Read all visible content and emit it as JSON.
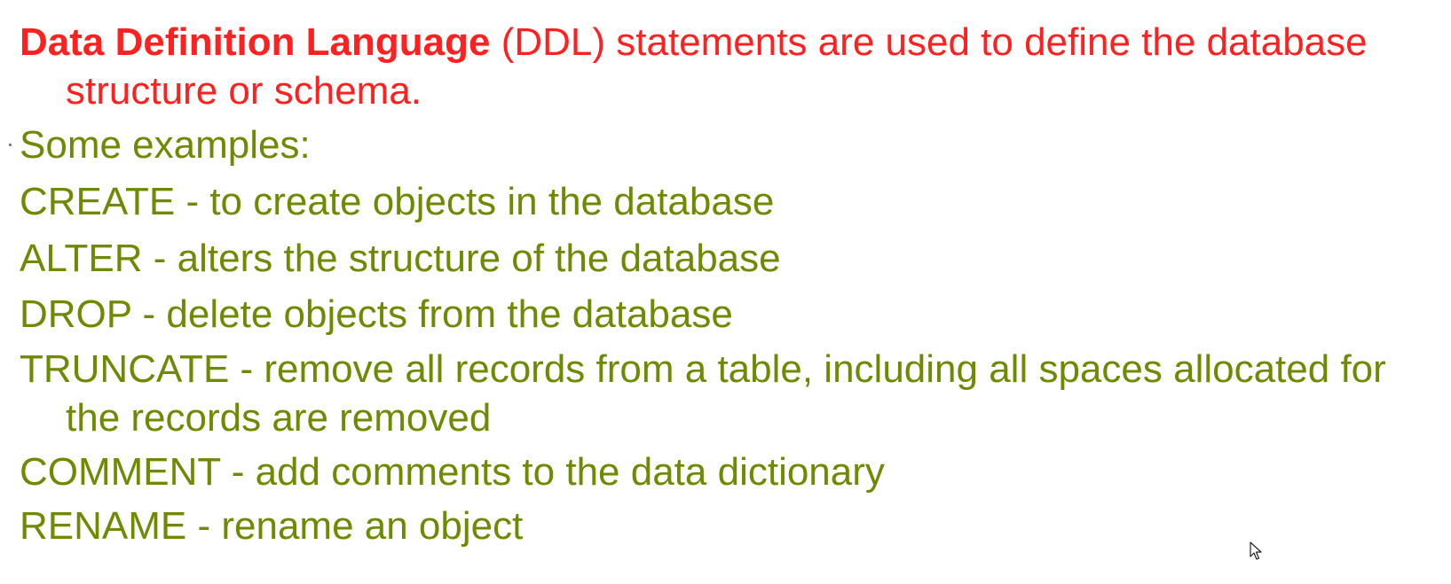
{
  "intro": {
    "bold_term": "Data Definition Language",
    "rest": " (DDL) statements are used to define the database structure or schema."
  },
  "examples_heading": "Some examples:",
  "commands": [
    {
      "keyword": "CREATE",
      "description": " - to create objects in the database"
    },
    {
      "keyword": "ALTER",
      "description": " - alters the structure of the database"
    },
    {
      "keyword": "DROP",
      "description": " - delete objects from the database"
    },
    {
      "keyword": "TRUNCATE",
      "description": " - remove all records from a table, including all spaces allocated for the records are removed"
    },
    {
      "keyword": "COMMENT",
      "description": " - add comments to the data dictionary"
    },
    {
      "keyword": "RENAME",
      "description": " - rename an object"
    }
  ],
  "colors": {
    "heading_red": "#ff2020",
    "body_green": "#6e8a00"
  },
  "icons": {
    "cursor": "mouse-pointer-icon"
  }
}
